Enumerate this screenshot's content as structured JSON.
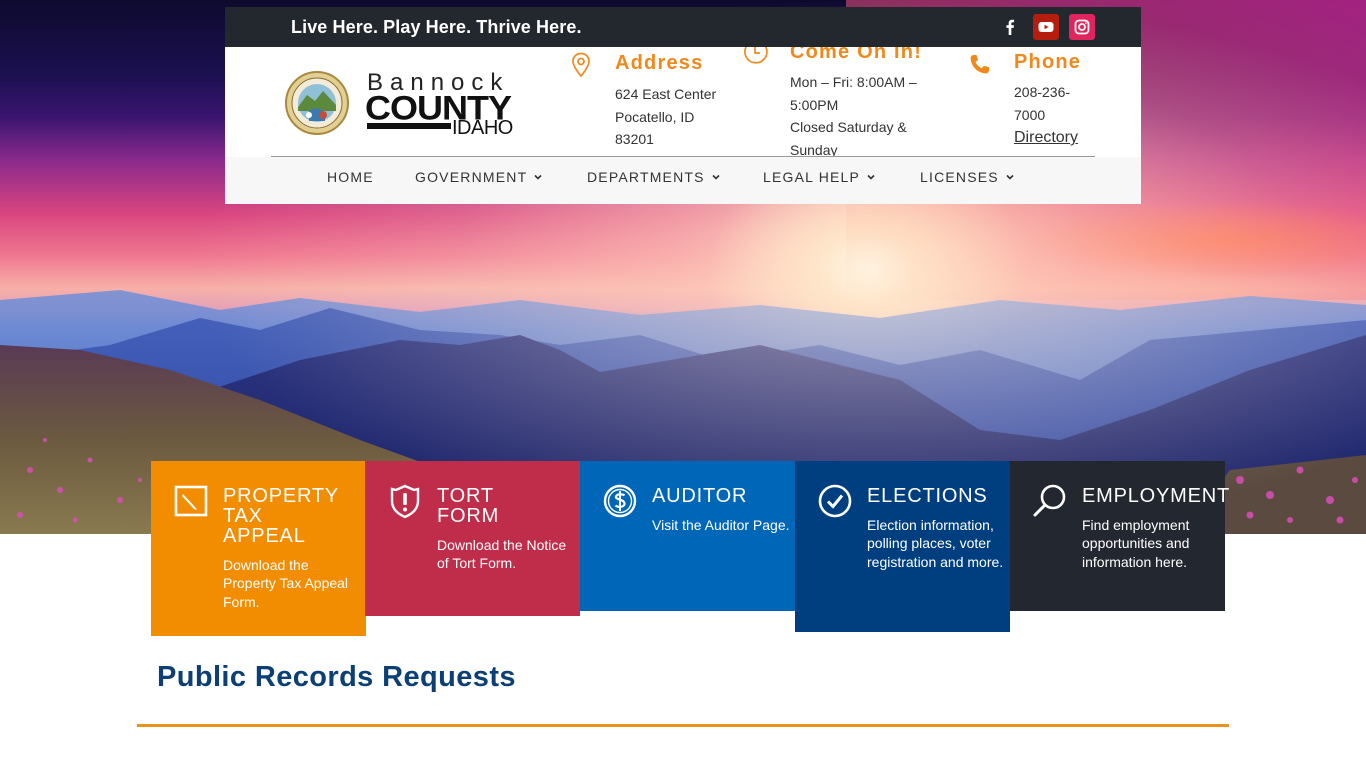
{
  "topbar": {
    "tagline": "Live Here. Play Here. Thrive Here.",
    "social": [
      {
        "icon": "facebook-icon",
        "label": "Facebook",
        "color": "#ffffff"
      },
      {
        "icon": "youtube-icon",
        "label": "YouTube",
        "color": "#b61d0f"
      },
      {
        "icon": "instagram-icon",
        "label": "Instagram",
        "color": "#e0245e"
      }
    ]
  },
  "logo": {
    "line1": "Bannock",
    "line2": "COUNTY",
    "line3": "IDAHO",
    "seal_alt": "Bannock County State of Idaho seal"
  },
  "info": {
    "address": {
      "title": "Address",
      "lines": [
        "624 East Center",
        "Pocatello, ID",
        "83201"
      ]
    },
    "hours": {
      "title": "Come On In!",
      "lines": [
        "Mon – Fri: 8:00AM –",
        "5:00PM",
        "Closed Saturday &",
        "Sunday"
      ]
    },
    "phone": {
      "title": "Phone",
      "lines": [
        "208-236-",
        "7000"
      ],
      "link": "Directory"
    },
    "accent_color": "#f0891c"
  },
  "nav": {
    "items": [
      {
        "label": "HOME",
        "dropdown": false
      },
      {
        "label": "GOVERNMENT",
        "dropdown": true
      },
      {
        "label": "DEPARTMENTS",
        "dropdown": true
      },
      {
        "label": "LEGAL HELP",
        "dropdown": true
      },
      {
        "label": "LICENSES",
        "dropdown": true
      }
    ]
  },
  "tiles": [
    {
      "title": "PROPERTY\nTAX\nAPPEAL",
      "desc": "Download the Property Tax Appeal Form.",
      "icon": "edit-icon",
      "color": "#f28c00"
    },
    {
      "title": "TORT\nFORM",
      "desc": "Download the Notice of Tort Form.",
      "icon": "shield-alert-icon",
      "color": "#c02d4a"
    },
    {
      "title": "AUDITOR",
      "desc": "Visit the Auditor Page.",
      "icon": "dollar-circle-icon",
      "color": "#0067b8"
    },
    {
      "title": "ELECTIONS",
      "desc": "Election information, polling places, voter registration and more.",
      "icon": "check-circle-icon",
      "color": "#003f7f"
    },
    {
      "title": "EMPLOYMENT",
      "desc": "Find employment opportunities and information here.",
      "icon": "search-icon",
      "color": "#23272f"
    }
  ],
  "content": {
    "section_title": "Public Records Requests",
    "title_color": "#0b3f76",
    "rule_color": "#e8921f"
  }
}
